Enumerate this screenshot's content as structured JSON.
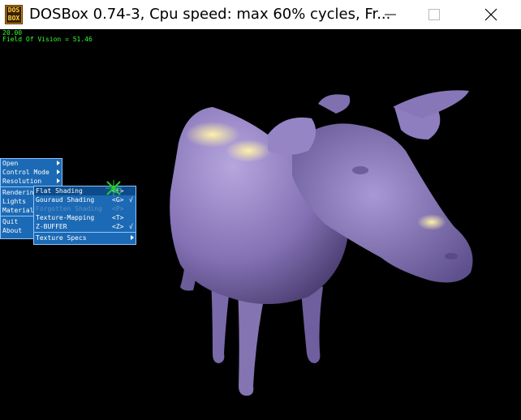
{
  "window": {
    "title": "DOSBox 0.74-3, Cpu speed: max  60% cycles, Fr...",
    "icon_top": "DOS",
    "icon_bottom": "BOX"
  },
  "hud": {
    "fps": "20.00",
    "fov": "Field Of Vision = 51.46"
  },
  "main_menu": [
    {
      "label": "Open",
      "submenu": true
    },
    {
      "label": "Control Mode",
      "submenu": true
    },
    {
      "label": "Resolution",
      "submenu": true
    },
    {
      "label": "Rendering",
      "submenu": true
    },
    {
      "label": "Lights",
      "submenu": false
    },
    {
      "label": "Materials",
      "submenu": false
    },
    {
      "label": "Quit",
      "submenu": false
    },
    {
      "label": "About",
      "submenu": false
    }
  ],
  "render_menu": [
    {
      "label": "Flat Shading",
      "shortcut": "<F>",
      "check": ""
    },
    {
      "label": "Gouraud Shading",
      "shortcut": "<G>",
      "check": "√"
    },
    {
      "label": "Forgotten Shading",
      "shortcut": "<P>",
      "check": ""
    },
    {
      "label": "Texture-Mapping",
      "shortcut": "<T>",
      "check": ""
    },
    {
      "label": "Z-BUFFER",
      "shortcut": "<Z>",
      "check": "√"
    },
    {
      "label": "Texture Specs",
      "shortcut": "",
      "check": ""
    }
  ],
  "colors": {
    "menu_bg": "#1c6ab5",
    "hud_text": "#33ff33",
    "cow": "#8a78b8"
  }
}
